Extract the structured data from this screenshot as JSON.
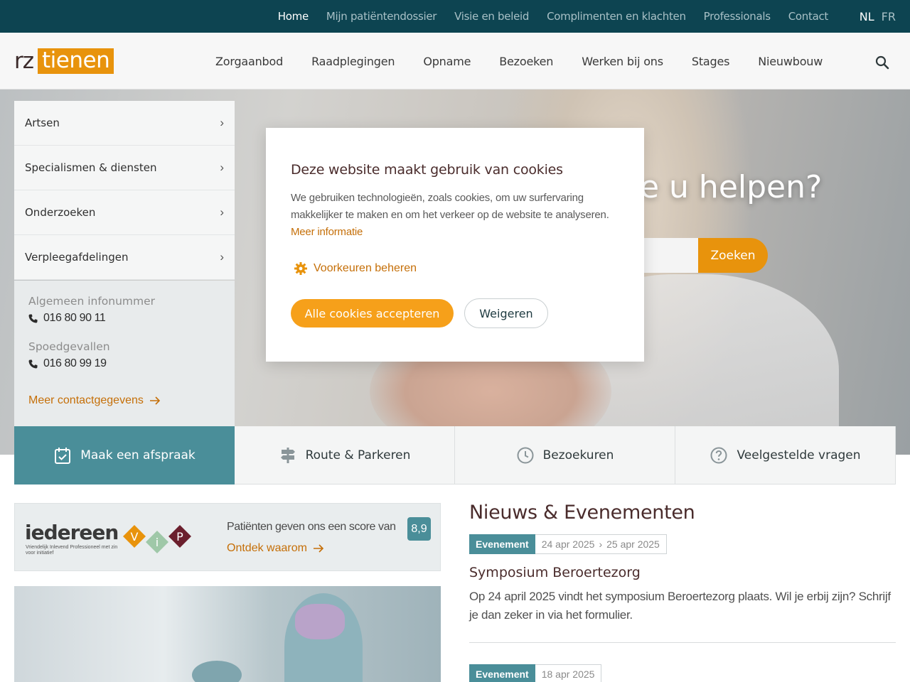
{
  "topbar": {
    "links": [
      "Home",
      "Mijn patiëntendossier",
      "Visie en beleid",
      "Complimenten en klachten",
      "Professionals",
      "Contact"
    ],
    "active_index": 0,
    "languages": [
      "NL",
      "FR"
    ],
    "active_language": "NL"
  },
  "header": {
    "logo_part1": "rz",
    "logo_part2": "tienen",
    "nav": [
      "Zorgaanbod",
      "Raadplegingen",
      "Opname",
      "Bezoeken",
      "Werken bij ons",
      "Stages",
      "Nieuwbouw"
    ],
    "search_icon": "search-icon"
  },
  "hero": {
    "title_visible": "e u helpen?",
    "search_button": "Zoeken"
  },
  "sidemenu": {
    "items": [
      "Artsen",
      "Specialismen & diensten",
      "Onderzoeken",
      "Verpleegafdelingen"
    ]
  },
  "contact": {
    "general_label": "Algemeen infonummer",
    "general_number": "016 80 90 11",
    "emergency_label": "Spoedgevallen",
    "emergency_number": "016 80 99 19",
    "more_link": "Meer contactgegevens"
  },
  "quicklinks": [
    {
      "label": "Maak een afspraak",
      "icon": "calendar-check-icon"
    },
    {
      "label": "Route & Parkeren",
      "icon": "signpost-icon"
    },
    {
      "label": "Bezoekuren",
      "icon": "clock-icon"
    },
    {
      "label": "Veelgestelde vragen",
      "icon": "question-circle-icon"
    }
  ],
  "vip": {
    "brand": "iedereen",
    "brand_sub": "Vriendelijk Inlevend Professioneel met zin voor initiatief",
    "letters": [
      "V",
      "i",
      "P"
    ],
    "score_text": "Patiënten geven ons een score van",
    "score": "8,9",
    "link": "Ontdek waarom"
  },
  "news": {
    "title": "Nieuws & Evenementen",
    "items": [
      {
        "tag": "Evenement",
        "date_start": "24 apr 2025",
        "date_end": "25 apr 2025",
        "heading": "Symposium Beroertezorg",
        "text": "Op 24 april 2025 vindt het symposium Beroertezorg plaats. Wil je erbij zijn? Schrijf je dan zeker in via het formulier."
      },
      {
        "tag": "Evenement",
        "date_start": "18 apr 2025"
      }
    ]
  },
  "cookie_modal": {
    "title": "Deze website maakt gebruik van cookies",
    "body": "We gebruiken technologieën, zoals cookies, om uw surfervaring makkelijker te maken en om het verkeer op de website te analyseren.",
    "more_info": "Meer informatie",
    "preferences": "Voorkeuren beheren",
    "accept": "Alle cookies accepteren",
    "deny": "Weigeren"
  },
  "colors": {
    "topbar": "#0d4451",
    "accent_orange": "#e8930c",
    "teal": "#4a8e99",
    "heading_brown": "#4a2c2c"
  }
}
